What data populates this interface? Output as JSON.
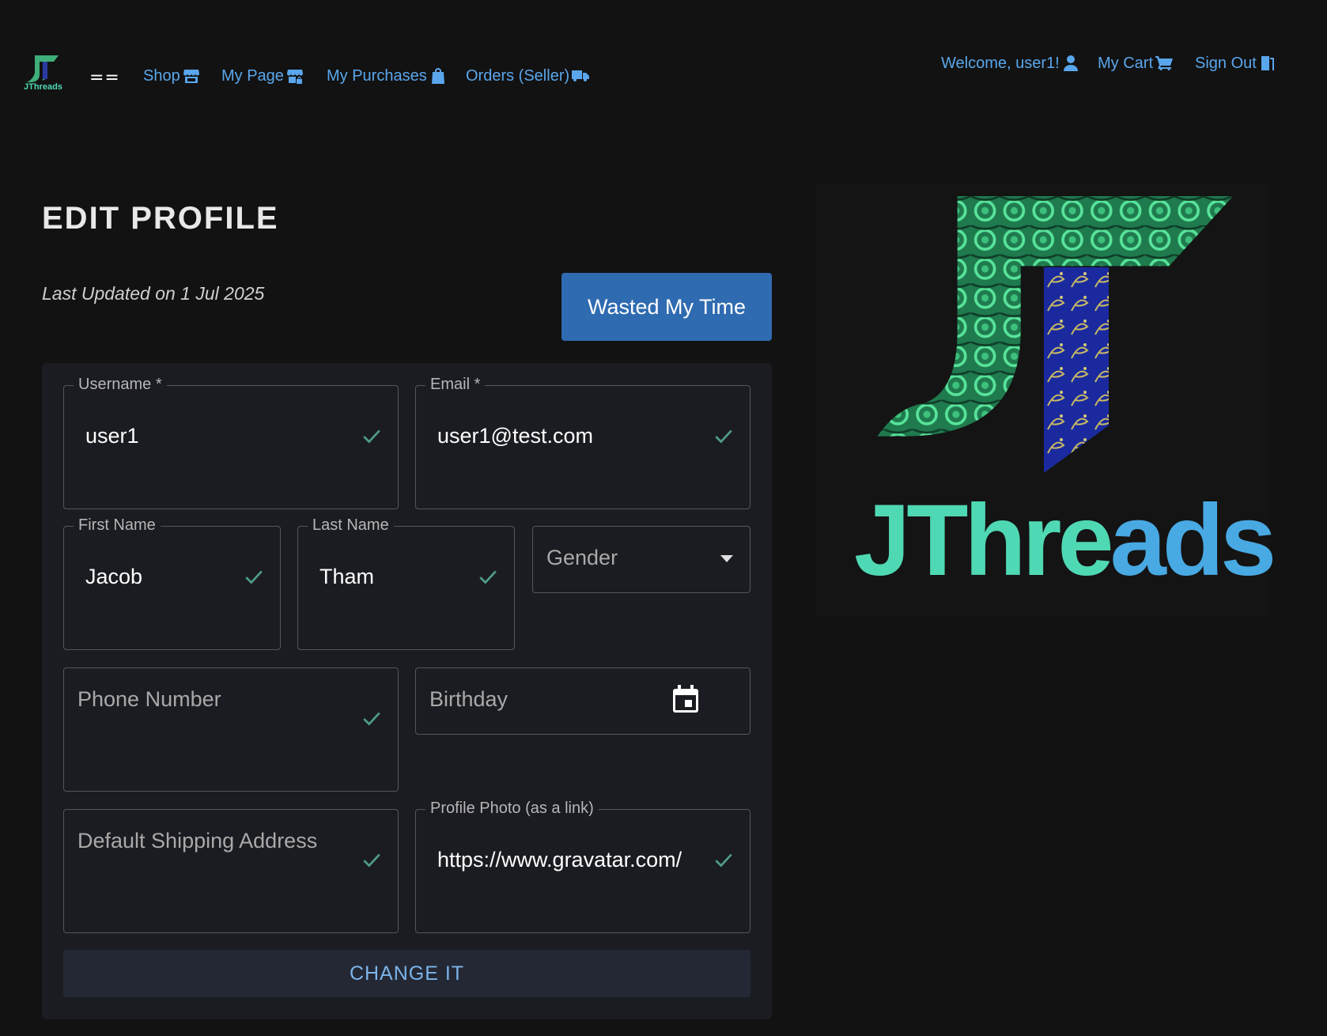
{
  "nav": {
    "logo_text": "JThreads",
    "menu_icon_text": "==",
    "links": [
      {
        "label": "Shop",
        "icon": "store-icon"
      },
      {
        "label": "My Page",
        "icon": "shop-lock-icon"
      },
      {
        "label": "My Purchases",
        "icon": "shopping-bag-icon"
      },
      {
        "label": "Orders (Seller)",
        "icon": "truck-icon"
      }
    ],
    "right": [
      {
        "label": "Welcome, user1!",
        "icon": "user-icon"
      },
      {
        "label": "My Cart",
        "icon": "cart-icon"
      },
      {
        "label": "Sign Out",
        "icon": "door-exit-icon"
      }
    ]
  },
  "page": {
    "title": "EDIT PROFILE",
    "last_updated": "Last Updated on 1 Jul 2025",
    "wasted_button": "Wasted My Time"
  },
  "form": {
    "username": {
      "label": "Username",
      "required_mark": "*",
      "value": "user1"
    },
    "email": {
      "label": "Email",
      "required_mark": "*",
      "value": "user1@test.com"
    },
    "first_name": {
      "label": "First Name",
      "value": "Jacob"
    },
    "last_name": {
      "label": "Last Name",
      "value": "Tham"
    },
    "gender": {
      "placeholder": "Gender"
    },
    "phone": {
      "placeholder": "Phone Number"
    },
    "birthday": {
      "placeholder": "Birthday"
    },
    "shipping": {
      "placeholder": "Default Shipping Address"
    },
    "photo": {
      "label": "Profile Photo (as a link)",
      "value": "https://www.gravatar.com/"
    },
    "submit_label": "CHANGE IT"
  },
  "brand": {
    "word_part1": "JThre",
    "word_part2": "ads"
  },
  "colors": {
    "background": "#121212",
    "card": "#1b1c22",
    "link": "#5aa6ec",
    "primary_button": "#2f6bb0",
    "check": "#4f9e85",
    "brand_green": "#4fd8b4",
    "brand_blue": "#48a9e3"
  }
}
